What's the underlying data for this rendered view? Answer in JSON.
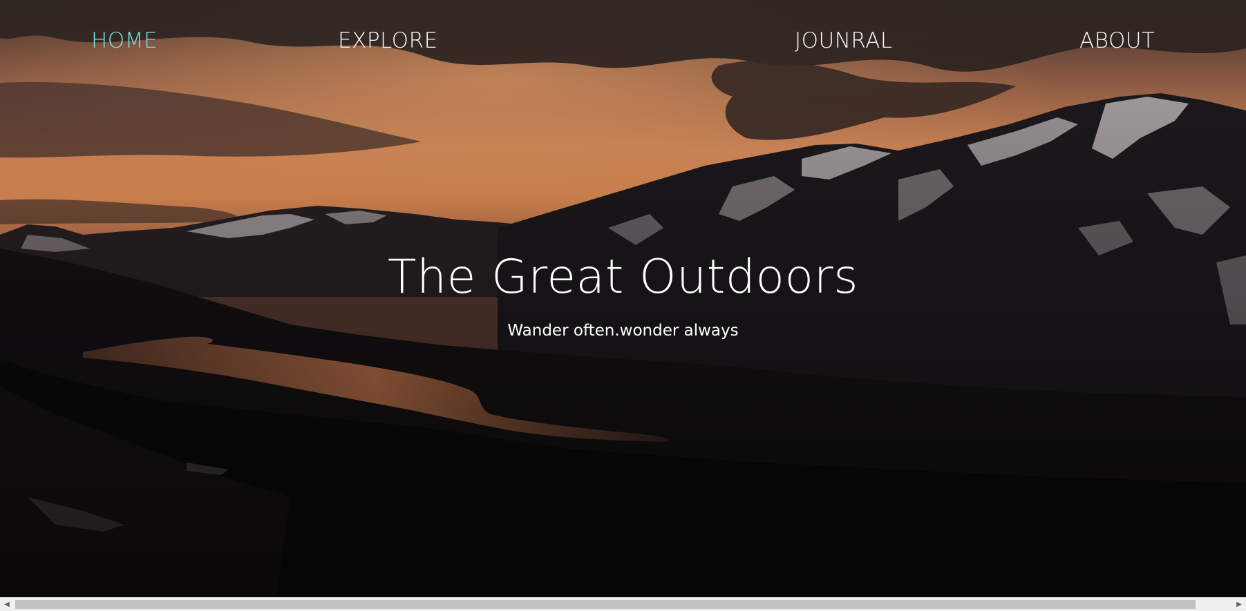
{
  "nav": {
    "items": [
      {
        "label": "HOME",
        "active": true
      },
      {
        "label": "EXPLORE",
        "active": false
      },
      {
        "label": "JOUNRAL",
        "active": false
      },
      {
        "label": "ABOUT",
        "active": false
      }
    ]
  },
  "hero": {
    "title": "The Great Outdoors",
    "subtitle": "Wander often.wonder always",
    "background": "sunset-mountain-lake-photo"
  },
  "colors": {
    "nav_active": "#7fe3dc",
    "nav_text": "#ffffff",
    "sky_glow": "#f08a4b"
  },
  "scrollbar": {
    "left_arrow_icon": "chevron-left-icon",
    "right_arrow_icon": "chevron-right-icon"
  }
}
